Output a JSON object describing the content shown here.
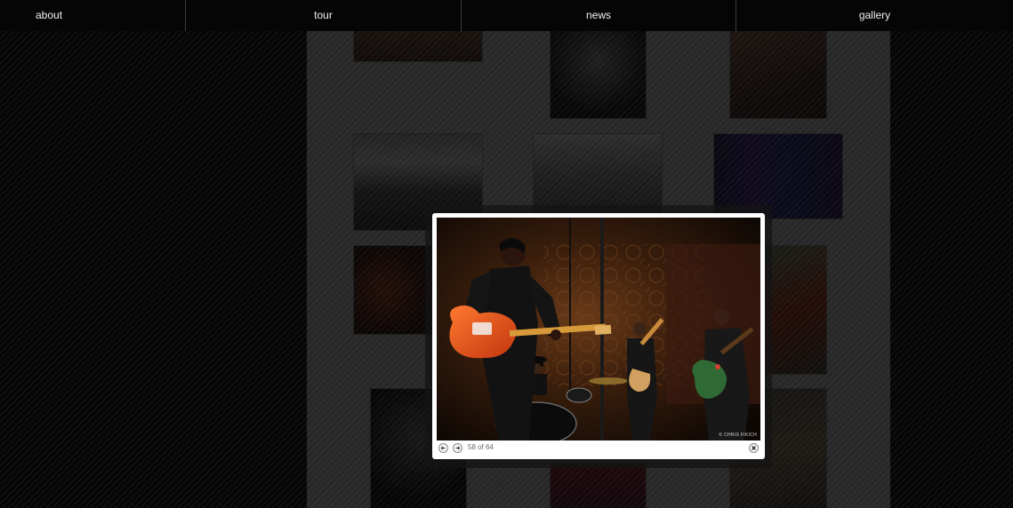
{
  "nav": {
    "items": [
      {
        "label": "about"
      },
      {
        "label": "tour"
      },
      {
        "label": "news"
      },
      {
        "label": "gallery"
      }
    ]
  },
  "lightbox": {
    "counter": "58 of 64",
    "credit": "© CHRIS FIKICH",
    "prev_icon": "arrow-left-icon",
    "next_icon": "arrow-right-icon",
    "close_icon": "close-icon"
  },
  "colors": {
    "nav_bg": "#050505",
    "panel_bg": "#8e8e8e",
    "guitar_accent": "#e8541a"
  }
}
